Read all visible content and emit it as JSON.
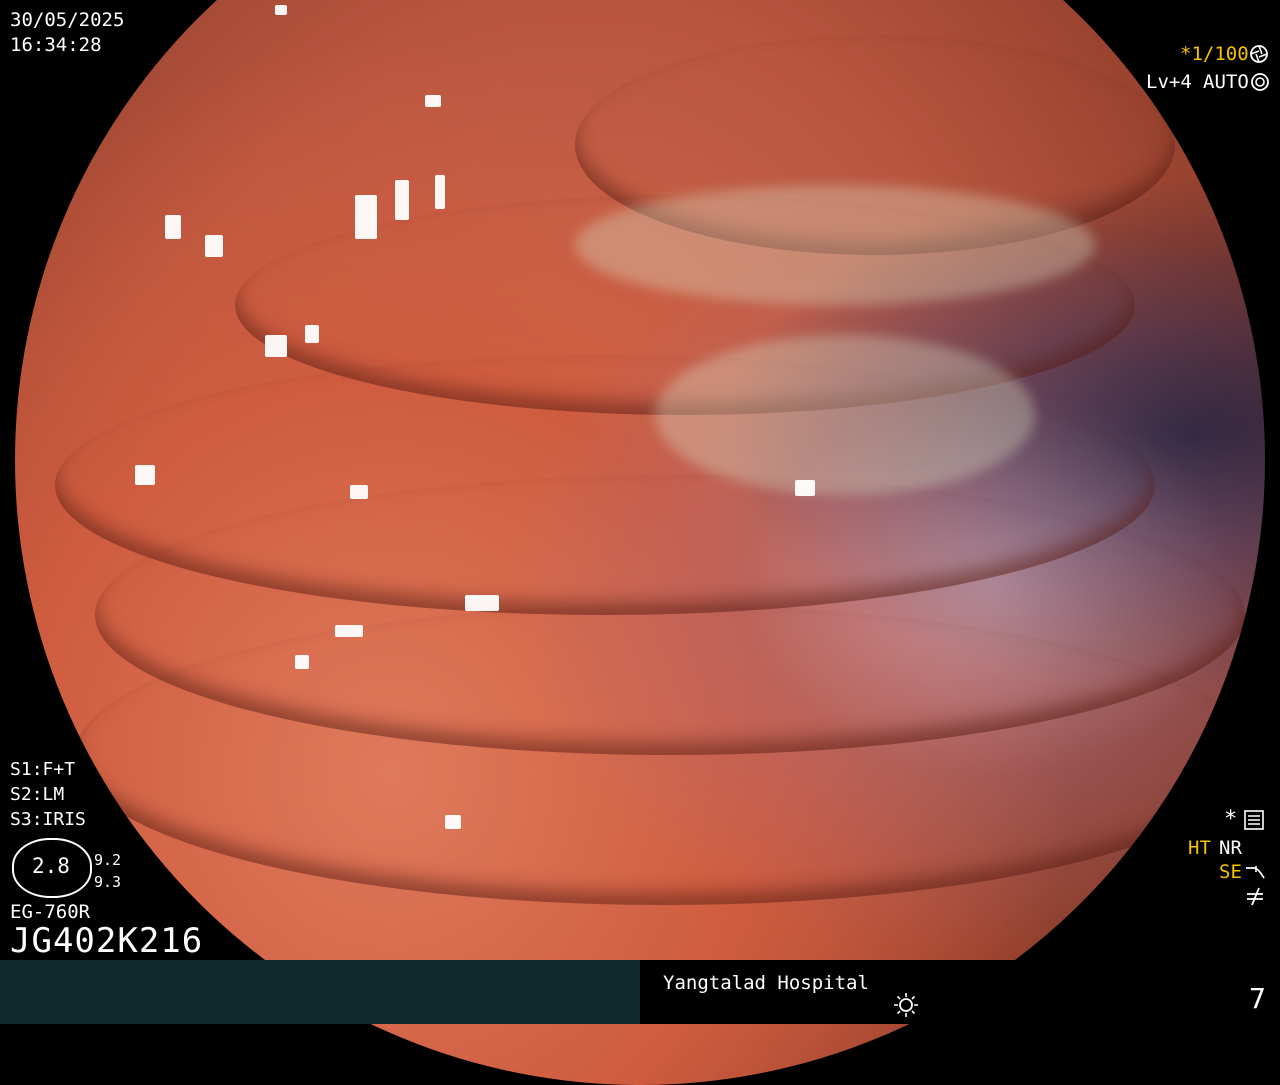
{
  "datetime": {
    "date": "30/05/2025",
    "time": "16:34:28"
  },
  "settings_top_right": {
    "shutter": "*1/100",
    "shutter_icon": "aperture-icon",
    "level": "Lv+4",
    "mode": "AUTO",
    "mode_icon": "iris-icon"
  },
  "scope_switches": [
    {
      "key": "S1",
      "value": "F+T"
    },
    {
      "key": "S2",
      "value": "LM"
    },
    {
      "key": "S3",
      "value": "IRIS"
    }
  ],
  "gauge": {
    "value": "2.8",
    "side_top": "9.2",
    "side_bottom": "9.3"
  },
  "scope_model": "EG-760R",
  "scope_serial": "JG402K216",
  "enhancement_flags": {
    "star": "*",
    "settings_icon": "sliders-icon",
    "ht": "HT",
    "nr": "NR",
    "se": "SE",
    "se_icon": "curve-icon",
    "last_icon": "not-equal-icon"
  },
  "footer": {
    "hospital": "Yangtalad Hospital",
    "light_icon": "sun-icon",
    "image_number": "7"
  },
  "colors": {
    "accent_yellow": "#f5c400",
    "footer_left_bg": "#0f2a2a"
  }
}
